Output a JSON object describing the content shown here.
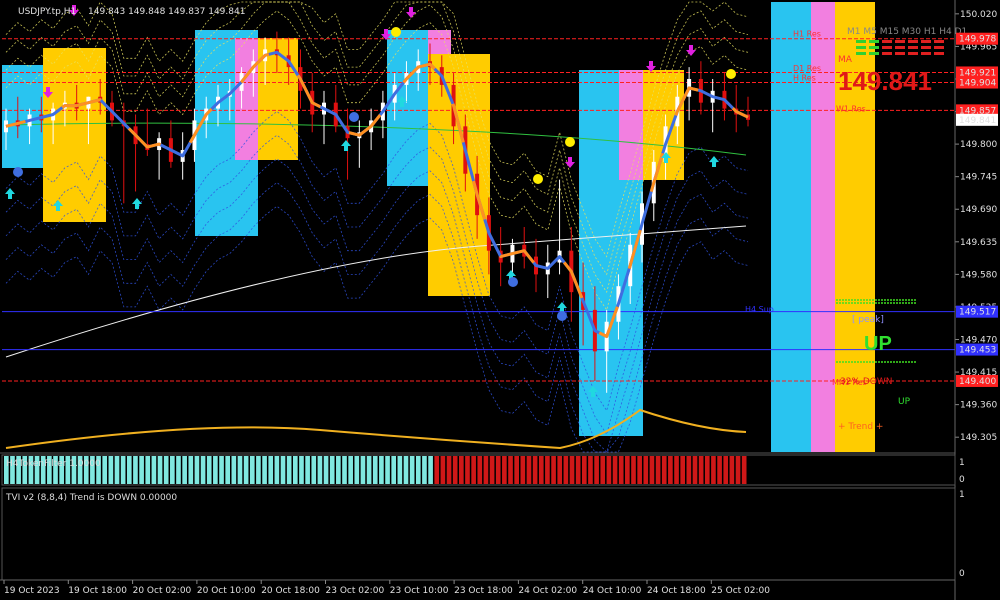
{
  "header": {
    "symbol_text": "USDJPY.tp,H1",
    "ohlc_text": "149.843 149.848 149.837 149.841"
  },
  "chart_data": {
    "type": "candlestick",
    "symbol": "USDJPY.tp",
    "timeframe": "H1",
    "ylim": [
      149.28,
      150.04
    ],
    "price_ticks": [
      "150.020",
      "149.965",
      "149.910",
      "149.855",
      "149.800",
      "149.745",
      "149.690",
      "149.635",
      "149.580",
      "149.525",
      "149.470",
      "149.415",
      "149.360",
      "149.305"
    ],
    "time_labels": [
      "19 Oct 2023",
      "19 Oct 18:00",
      "20 Oct 02:00",
      "20 Oct 10:00",
      "20 Oct 18:00",
      "23 Oct 02:00",
      "23 Oct 10:00",
      "23 Oct 18:00",
      "24 Oct 02:00",
      "24 Oct 10:00",
      "24 Oct 18:00",
      "25 Oct 02:00"
    ],
    "current_price": "149.841",
    "price_tags": [
      {
        "label": "149.978",
        "price": 149.978,
        "color": "#ff2020"
      },
      {
        "label": "149.921",
        "price": 149.921,
        "color": "#ff2020"
      },
      {
        "label": "149.904",
        "price": 149.904,
        "color": "#ff2020"
      },
      {
        "label": "149.857",
        "price": 149.857,
        "color": "#ff2020"
      },
      {
        "label": "149.841",
        "price": 149.841,
        "color": "#ffffff"
      },
      {
        "label": "149.517",
        "price": 149.517,
        "color": "#3030ff"
      },
      {
        "label": "149.453",
        "price": 149.453,
        "color": "#3030ff"
      },
      {
        "label": "149.400",
        "price": 149.4,
        "color": "#ff2020"
      }
    ],
    "level_labels": [
      {
        "text": "H1 Res",
        "price": 149.978,
        "color": "#ff3030"
      },
      {
        "text": "D1 Res",
        "price": 149.92,
        "color": "#ff3030"
      },
      {
        "text": "H Res",
        "price": 149.904,
        "color": "#ff3030"
      },
      {
        "text": "W1 Res",
        "price": 149.852,
        "color": "#ff3030"
      },
      {
        "text": "H4 Sup",
        "price": 149.513,
        "color": "#3030ff"
      },
      {
        "text": "MN1 Res",
        "price": 149.39,
        "color": "#ff3030"
      }
    ],
    "candles": [
      {
        "o": 149.82,
        "h": 149.86,
        "l": 149.79,
        "c": 149.84
      },
      {
        "o": 149.84,
        "h": 149.88,
        "l": 149.81,
        "c": 149.83
      },
      {
        "o": 149.83,
        "h": 149.86,
        "l": 149.8,
        "c": 149.85
      },
      {
        "o": 149.85,
        "h": 149.88,
        "l": 149.82,
        "c": 149.84
      },
      {
        "o": 149.84,
        "h": 149.87,
        "l": 149.8,
        "c": 149.86
      },
      {
        "o": 149.86,
        "h": 149.89,
        "l": 149.83,
        "c": 149.87
      },
      {
        "o": 149.87,
        "h": 149.9,
        "l": 149.84,
        "c": 149.86
      },
      {
        "o": 149.86,
        "h": 149.88,
        "l": 149.8,
        "c": 149.88
      },
      {
        "o": 149.88,
        "h": 149.91,
        "l": 149.85,
        "c": 149.87
      },
      {
        "o": 149.87,
        "h": 149.89,
        "l": 149.83,
        "c": 149.84
      },
      {
        "o": 149.84,
        "h": 149.87,
        "l": 149.7,
        "c": 149.83
      },
      {
        "o": 149.83,
        "h": 149.85,
        "l": 149.72,
        "c": 149.8
      },
      {
        "o": 149.8,
        "h": 149.86,
        "l": 149.78,
        "c": 149.79
      },
      {
        "o": 149.79,
        "h": 149.82,
        "l": 149.74,
        "c": 149.81
      },
      {
        "o": 149.81,
        "h": 149.84,
        "l": 149.76,
        "c": 149.77
      },
      {
        "o": 149.77,
        "h": 149.82,
        "l": 149.74,
        "c": 149.79
      },
      {
        "o": 149.79,
        "h": 149.86,
        "l": 149.77,
        "c": 149.84
      },
      {
        "o": 149.84,
        "h": 149.88,
        "l": 149.81,
        "c": 149.86
      },
      {
        "o": 149.86,
        "h": 149.9,
        "l": 149.83,
        "c": 149.88
      },
      {
        "o": 149.88,
        "h": 149.91,
        "l": 149.84,
        "c": 149.89
      },
      {
        "o": 149.89,
        "h": 149.93,
        "l": 149.86,
        "c": 149.92
      },
      {
        "o": 149.92,
        "h": 149.96,
        "l": 149.88,
        "c": 149.94
      },
      {
        "o": 149.94,
        "h": 149.98,
        "l": 149.9,
        "c": 149.96
      },
      {
        "o": 149.96,
        "h": 149.99,
        "l": 149.92,
        "c": 149.95
      },
      {
        "o": 149.95,
        "h": 149.98,
        "l": 149.9,
        "c": 149.93
      },
      {
        "o": 149.93,
        "h": 149.96,
        "l": 149.86,
        "c": 149.89
      },
      {
        "o": 149.89,
        "h": 149.92,
        "l": 149.82,
        "c": 149.85
      },
      {
        "o": 149.85,
        "h": 149.89,
        "l": 149.8,
        "c": 149.87
      },
      {
        "o": 149.87,
        "h": 149.9,
        "l": 149.82,
        "c": 149.83
      },
      {
        "o": 149.83,
        "h": 149.86,
        "l": 149.74,
        "c": 149.81
      },
      {
        "o": 149.81,
        "h": 149.84,
        "l": 149.76,
        "c": 149.82
      },
      {
        "o": 149.82,
        "h": 149.86,
        "l": 149.79,
        "c": 149.84
      },
      {
        "o": 149.84,
        "h": 149.89,
        "l": 149.81,
        "c": 149.87
      },
      {
        "o": 149.87,
        "h": 149.92,
        "l": 149.84,
        "c": 149.9
      },
      {
        "o": 149.9,
        "h": 149.94,
        "l": 149.87,
        "c": 149.92
      },
      {
        "o": 149.92,
        "h": 149.96,
        "l": 149.89,
        "c": 149.94
      },
      {
        "o": 149.94,
        "h": 149.97,
        "l": 149.9,
        "c": 149.93
      },
      {
        "o": 149.93,
        "h": 149.95,
        "l": 149.88,
        "c": 149.9
      },
      {
        "o": 149.9,
        "h": 149.92,
        "l": 149.8,
        "c": 149.83
      },
      {
        "o": 149.83,
        "h": 149.85,
        "l": 149.72,
        "c": 149.75
      },
      {
        "o": 149.75,
        "h": 149.78,
        "l": 149.64,
        "c": 149.68
      },
      {
        "o": 149.68,
        "h": 149.71,
        "l": 149.58,
        "c": 149.62
      },
      {
        "o": 149.62,
        "h": 149.66,
        "l": 149.56,
        "c": 149.6
      },
      {
        "o": 149.6,
        "h": 149.64,
        "l": 149.57,
        "c": 149.63
      },
      {
        "o": 149.63,
        "h": 149.66,
        "l": 149.59,
        "c": 149.61
      },
      {
        "o": 149.61,
        "h": 149.64,
        "l": 149.55,
        "c": 149.58
      },
      {
        "o": 149.58,
        "h": 149.63,
        "l": 149.54,
        "c": 149.6
      },
      {
        "o": 149.6,
        "h": 149.74,
        "l": 149.58,
        "c": 149.62
      },
      {
        "o": 149.62,
        "h": 149.66,
        "l": 149.5,
        "c": 149.55
      },
      {
        "o": 149.55,
        "h": 149.6,
        "l": 149.46,
        "c": 149.52
      },
      {
        "o": 149.52,
        "h": 149.56,
        "l": 149.4,
        "c": 149.45
      },
      {
        "o": 149.45,
        "h": 149.52,
        "l": 149.38,
        "c": 149.5
      },
      {
        "o": 149.5,
        "h": 149.58,
        "l": 149.47,
        "c": 149.56
      },
      {
        "o": 149.56,
        "h": 149.65,
        "l": 149.53,
        "c": 149.63
      },
      {
        "o": 149.63,
        "h": 149.72,
        "l": 149.6,
        "c": 149.7
      },
      {
        "o": 149.7,
        "h": 149.79,
        "l": 149.67,
        "c": 149.77
      },
      {
        "o": 149.77,
        "h": 149.85,
        "l": 149.74,
        "c": 149.83
      },
      {
        "o": 149.83,
        "h": 149.9,
        "l": 149.8,
        "c": 149.88
      },
      {
        "o": 149.88,
        "h": 149.93,
        "l": 149.84,
        "c": 149.91
      },
      {
        "o": 149.91,
        "h": 149.94,
        "l": 149.85,
        "c": 149.87
      },
      {
        "o": 149.87,
        "h": 149.91,
        "l": 149.82,
        "c": 149.89
      },
      {
        "o": 149.89,
        "h": 149.92,
        "l": 149.84,
        "c": 149.86
      },
      {
        "o": 149.86,
        "h": 149.9,
        "l": 149.82,
        "c": 149.85
      },
      {
        "o": 149.85,
        "h": 149.88,
        "l": 149.83,
        "c": 149.841
      }
    ]
  },
  "right_panel": {
    "timeframes": "M1 M5 M15 M30 H1 H4 D1",
    "big_price": "149.841",
    "ma_hint": "MA",
    "peak_label": "[ peak]",
    "up_big": "UP",
    "pct_down": "32% DOWN",
    "up_small": "UP",
    "trend_label": "+   Trend   +"
  },
  "subwindow1": {
    "label": "H4TokenFilter 1.0000",
    "scale_top": "1",
    "scale_bottom": "0",
    "cyan_bars": 70,
    "red_bars": 51
  },
  "subwindow2": {
    "label": "TVI v2 (8,8,4) Trend is DOWN 0.00000",
    "scale_top": "1",
    "scale_bottom": "0"
  },
  "colors": {
    "cyan": "#29c4f0",
    "magenta": "#f27fe0",
    "yellow": "#ffcc00",
    "bull_candle": "#ffffff",
    "bear_candle": "#e01010",
    "blue_line": "#3f6ee0",
    "orange_line": "#ff9020"
  }
}
